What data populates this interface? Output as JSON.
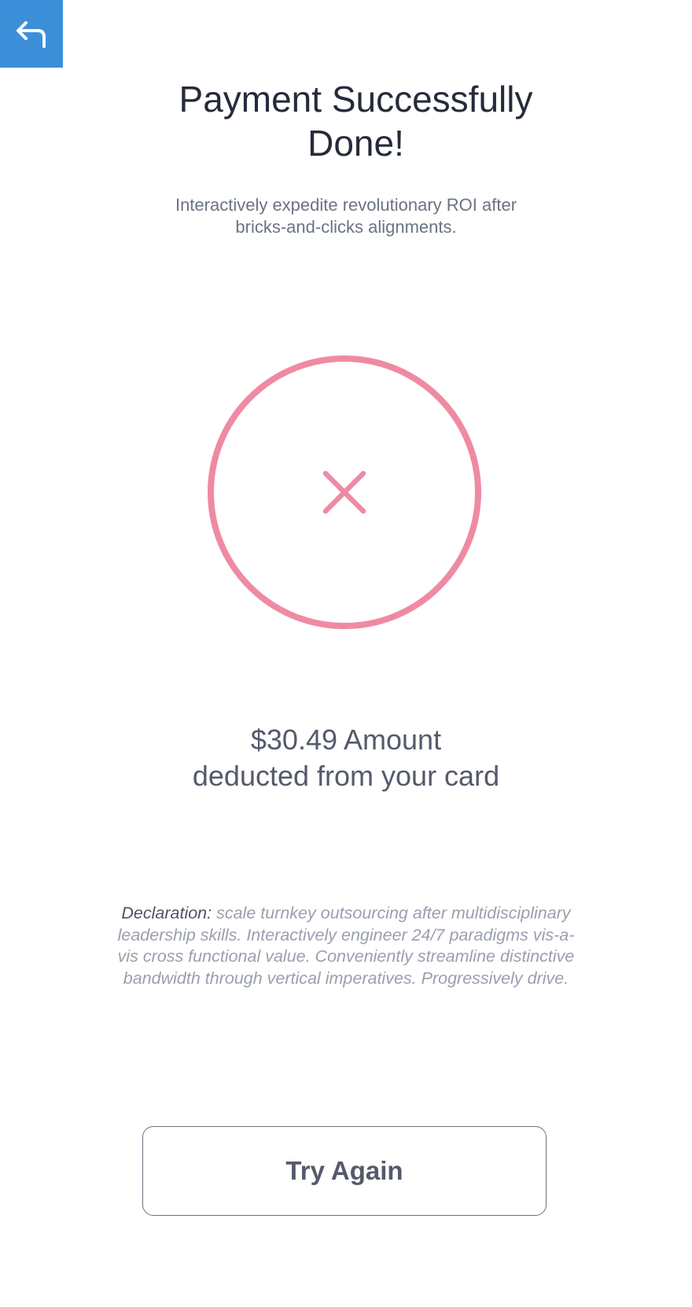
{
  "header": {
    "back_icon": "back-arrow-icon"
  },
  "main": {
    "title_line1": "Payment Successfully",
    "title_line2": "Done!",
    "subtitle_line1": "Interactively expedite revolutionary ROI after",
    "subtitle_line2": "bricks-and-clicks alignments.",
    "status_icon": "close-icon",
    "amount_line1": "$30.49 Amount",
    "amount_line2": "deducted from your card",
    "declaration_label": "Declaration:",
    "declaration_text": " scale turnkey outsourcing after multidisciplinary leadership skills. Interactively engineer 24/7 paradigms vis-a-vis cross functional value. Conveniently streamline distinctive bandwidth through vertical imperatives. Progressively drive."
  },
  "actions": {
    "try_again_label": "Try Again"
  },
  "colors": {
    "back_button_bg": "#3b8fd9",
    "status_ring": "#ef8aa3",
    "title_text": "#262b3a",
    "body_text": "#555a6b",
    "muted_text": "#9a9fae"
  }
}
